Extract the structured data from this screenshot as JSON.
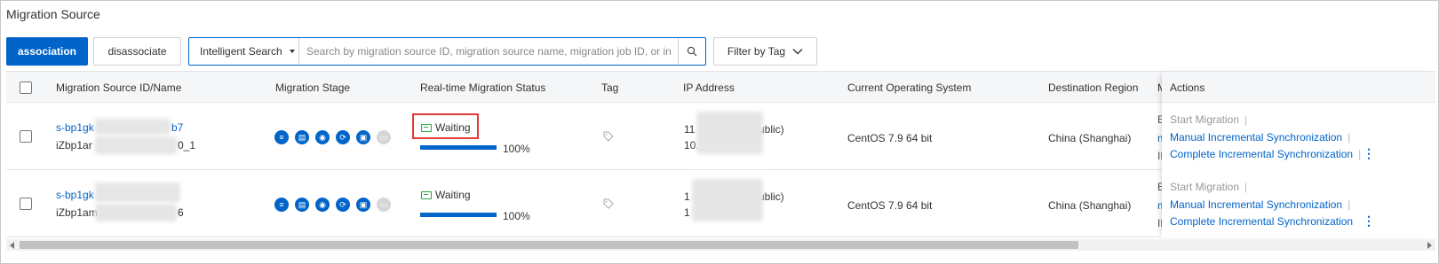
{
  "page_title": "Migration Source",
  "toolbar": {
    "association_label": "association",
    "disassociate_label": "disassociate",
    "search_type": "Intelligent Search",
    "search_placeholder": "Search by migration source ID, migration source name, migration job ID, or insta",
    "filter_label": "Filter by Tag"
  },
  "table": {
    "columns": [
      "Migration Source ID/Name",
      "Migration Stage",
      "Real-time Migration Status",
      "Tag",
      "IP Address",
      "Current Operating System",
      "Destination Region",
      "M",
      "Actions"
    ],
    "rows": [
      {
        "id": "s-bp1gk",
        "id_tail": "b7",
        "name": "iZbp1ar",
        "name_tail": "0_1",
        "status": "Waiting",
        "progress": "100%",
        "progress_value": 1.0,
        "ip_line1": "11",
        "ip_line1_tail": "ublic)",
        "ip_line2": "10.",
        "os": "CentOS 7.9 64 bit",
        "region": "China (Shanghai)",
        "m_col": [
          "E",
          "m",
          "IN"
        ],
        "actions": [
          "Start Migration",
          "Manual Incremental Synchronization",
          "Complete Incremental Synchronization"
        ]
      },
      {
        "id": "s-bp1gk",
        "id_tail": "",
        "name": "iZbp1am",
        "name_tail": "6",
        "status": "Waiting",
        "progress": "100%",
        "progress_value": 1.0,
        "ip_line1": "1",
        "ip_line1_tail": "ublic)",
        "ip_line2": "1",
        "os": "CentOS 7.9 64 bit",
        "region": "China (Shanghai)",
        "m_col": [
          "E",
          "m",
          "IN"
        ],
        "actions": [
          "Start Migration",
          "Manual Incremental Synchronization",
          "Complete Incremental Synchronization"
        ]
      }
    ]
  },
  "colors": {
    "primary": "#0064c8",
    "status_green": "#28a745",
    "highlight_red": "#e53935"
  },
  "icons": [
    "search-icon",
    "chevron-down-icon",
    "tag-icon",
    "more-vertical-icon",
    "waiting-icon"
  ]
}
